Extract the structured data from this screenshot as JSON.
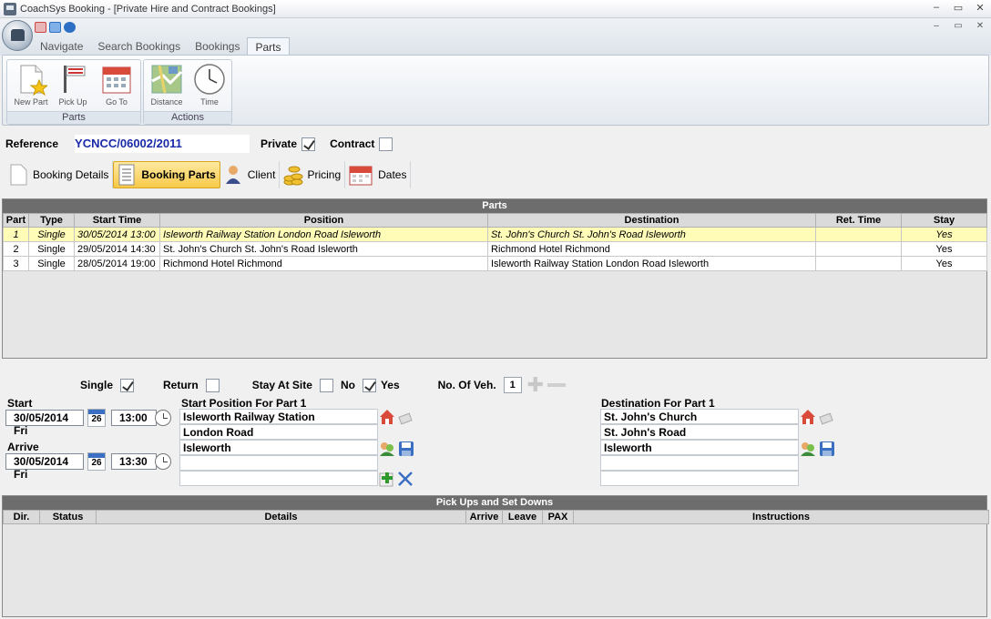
{
  "window": {
    "title": "CoachSys Booking - [Private Hire and Contract Bookings]",
    "controls": [
      "–",
      "▭",
      "✕"
    ]
  },
  "ribbon": {
    "tabs": [
      "Navigate",
      "Search Bookings",
      "Bookings",
      "Parts"
    ],
    "active_tab": "Parts",
    "groups": [
      {
        "label": "Parts",
        "buttons": [
          "New Part",
          "Pick Up",
          "Go To"
        ]
      },
      {
        "label": "Actions",
        "buttons": [
          "Distance",
          "Time"
        ]
      }
    ]
  },
  "reference": {
    "label": "Reference",
    "value": "YCNCC/06002/2011",
    "private_label": "Private",
    "private_checked": true,
    "contract_label": "Contract",
    "contract_checked": false
  },
  "subtabs": [
    "Booking Details",
    "Booking Parts",
    "Client",
    "Pricing",
    "Dates"
  ],
  "active_subtab": "Booking Parts",
  "parts_grid": {
    "title": "Parts",
    "columns": [
      "Part",
      "Type",
      "Start Time",
      "Position",
      "Destination",
      "Ret. Time",
      "Stay"
    ],
    "rows": [
      {
        "part": "1",
        "type": "Single",
        "start": "30/05/2014 13:00",
        "position": "Isleworth Railway Station London Road Isleworth",
        "destination": "St. John's Church St. John's Road Isleworth",
        "ret": "",
        "stay": "Yes"
      },
      {
        "part": "2",
        "type": "Single",
        "start": "29/05/2014 14:30",
        "position": "St. John's Church St. John's Road Isleworth",
        "destination": "Richmond Hotel Richmond",
        "ret": "",
        "stay": "Yes"
      },
      {
        "part": "3",
        "type": "Single",
        "start": "28/05/2014 19:00",
        "position": "Richmond Hotel Richmond",
        "destination": "Isleworth Railway Station London Road Isleworth",
        "ret": "",
        "stay": "Yes"
      }
    ]
  },
  "options": {
    "single_label": "Single",
    "single_checked": true,
    "return_label": "Return",
    "return_checked": false,
    "stay_label": "Stay At Site",
    "no_label": "No",
    "no_checked": false,
    "yes_label": "Yes",
    "yes_checked": true,
    "veh_label": "No. Of Veh.",
    "veh_value": "1"
  },
  "start": {
    "label": "Start",
    "date": "30/05/2014 Fri",
    "cal_day": "26",
    "time": "13:00"
  },
  "arrive": {
    "label": "Arrive",
    "date": "30/05/2014 Fri",
    "cal_day": "26",
    "time": "13:30"
  },
  "start_position": {
    "label": "Start Position For Part 1",
    "lines": [
      "Isleworth Railway Station",
      "London Road",
      "Isleworth",
      "",
      ""
    ]
  },
  "destination": {
    "label": "Destination For Part 1",
    "lines": [
      "St. John's Church",
      "St. John's Road",
      "Isleworth",
      "",
      ""
    ]
  },
  "pickups_grid": {
    "title": "Pick Ups and Set Downs",
    "columns": [
      "Dir.",
      "Status",
      "Details",
      "Arrive",
      "Leave",
      "PAX",
      "Instructions"
    ]
  },
  "colors": {
    "selected_row": "#fffcb8",
    "active_subtab": "#f7c948",
    "reference_text": "#1a2aa8",
    "grid_title": "#6d6d6d"
  }
}
